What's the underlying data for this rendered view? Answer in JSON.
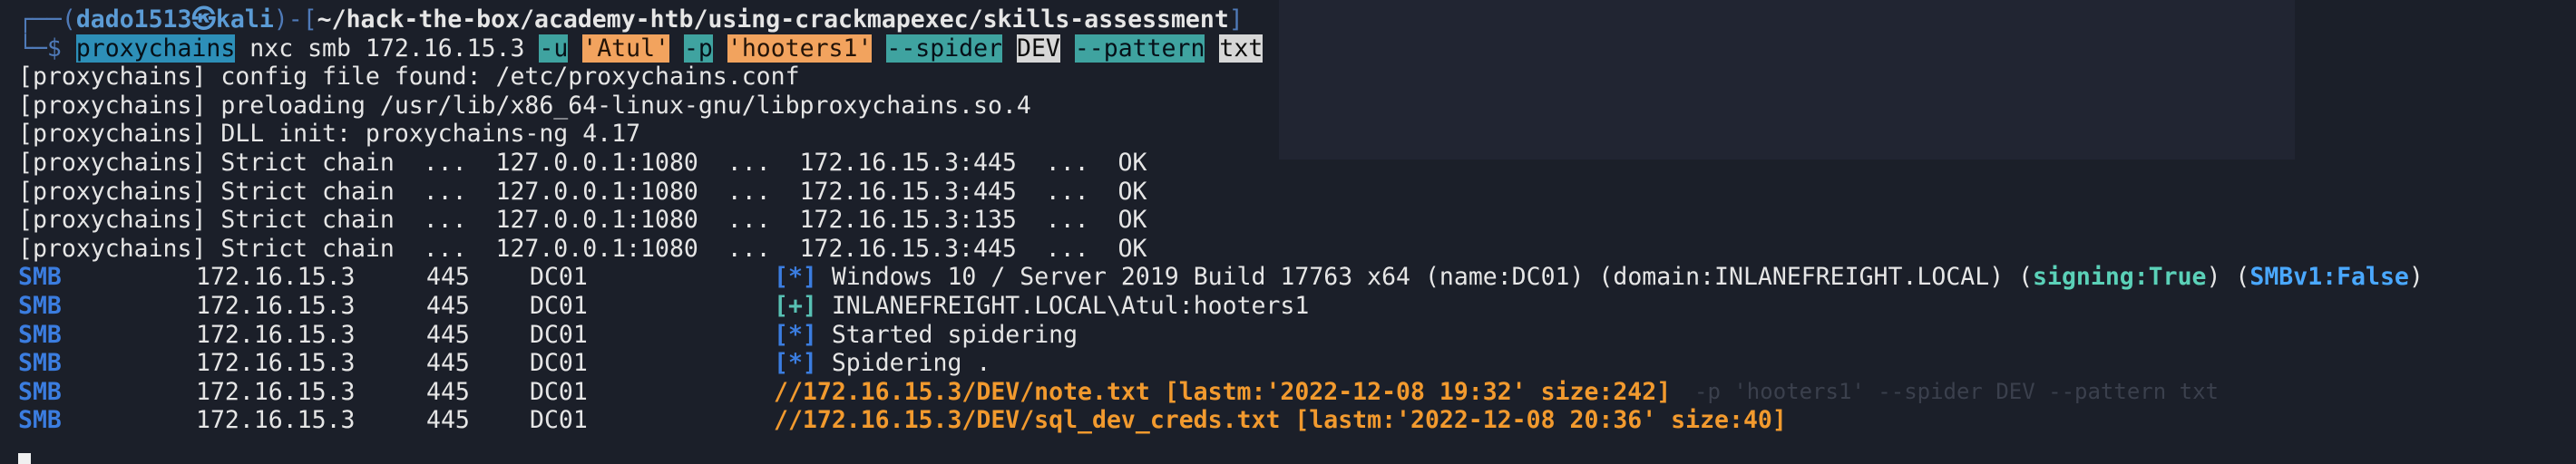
{
  "prompt": {
    "prefix": "┌──(",
    "user": "dado1513",
    "sep": "㉿",
    "host": "kali",
    "mid": ")-[",
    "path": "~/hack-the-box/academy-htb/using-crackmapexec/skills-assessment",
    "end": "]",
    "arrow": "└─$ "
  },
  "command": {
    "proxychains": "proxychains",
    "nxc": " nxc smb 172.16.15.3 ",
    "flag_u": "-u",
    "user": "'Atul'",
    "flag_p": "-p",
    "password": "'hooters1'",
    "spider": "--spider",
    "share": "DEV",
    "pattern": "--pattern",
    "ext": "txt"
  },
  "proxylines": [
    "[proxychains] config file found: /etc/proxychains.conf",
    "[proxychains] preloading /usr/lib/x86_64-linux-gnu/libproxychains.so.4",
    "[proxychains] DLL init: proxychains-ng 4.17",
    "[proxychains] Strict chain  ...  127.0.0.1:1080  ...  172.16.15.3:445  ...  OK",
    "[proxychains] Strict chain  ...  127.0.0.1:1080  ...  172.16.15.3:445  ...  OK",
    "[proxychains] Strict chain  ...  127.0.0.1:1080  ...  172.16.15.3:135  ...  OK",
    "[proxychains] Strict chain  ...  127.0.0.1:1080  ...  172.16.15.3:445  ...  OK"
  ],
  "smb": {
    "proto": "SMB",
    "ip": "172.16.15.3",
    "port": "445",
    "name": "DC01",
    "lines": [
      {
        "marker": "[*]",
        "text": " Windows 10 / Server 2019 Build 17763 x64 (name:DC01) (domain:INLANEFREIGHT.LOCAL) (",
        "signing": "signing:True",
        "mid": ") (",
        "smbv1": "SMBv1:False",
        "end": ")"
      },
      {
        "marker": "[+]",
        "text": " INLANEFREIGHT.LOCAL\\Atul:hooters1"
      },
      {
        "marker": "[*]",
        "text": " Started spidering"
      },
      {
        "marker": "[*]",
        "text": " Spidering ."
      }
    ],
    "files": [
      "//172.16.15.3/DEV/note.txt [lastm:'2022-12-08 19:32' size:242]",
      "//172.16.15.3/DEV/sql_dev_creds.txt [lastm:'2022-12-08 20:36' size:40]"
    ]
  },
  "ghost_command_text": "-p 'hooters1' --spider DEV --pattern txt"
}
